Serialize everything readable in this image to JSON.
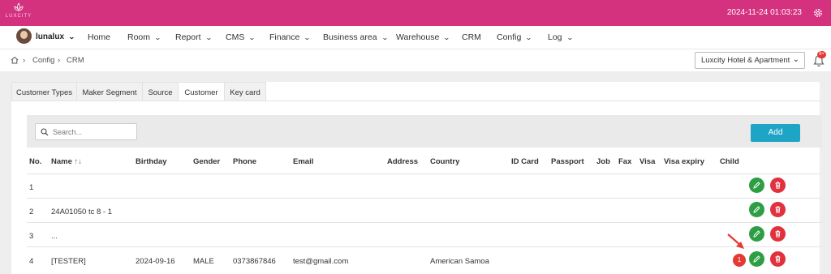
{
  "brand": {
    "logo_text": "LUXCITY",
    "color": "#d4317f"
  },
  "topbar": {
    "datetime": "2024-11-24 01:03:23"
  },
  "nav": {
    "username": "lunalux",
    "items": [
      "Home",
      "Room",
      "Report",
      "CMS",
      "Finance",
      "Business area",
      "Warehouse",
      "CRM",
      "Config",
      "Log"
    ]
  },
  "breadcrumb": {
    "items": [
      "Config",
      "CRM"
    ]
  },
  "hotel_select": {
    "value": "Luxcity Hotel & Apartment"
  },
  "notifications": {
    "count": "9+"
  },
  "tabs": [
    "Customer Types",
    "Maker Segment",
    "Source",
    "Customer",
    "Key card"
  ],
  "toolbar": {
    "search_placeholder": "Search...",
    "add_label": "Add"
  },
  "table": {
    "columns": [
      "No.",
      "Name",
      "Birthday",
      "Gender",
      "Phone",
      "Email",
      "Address",
      "Country",
      "ID Card",
      "Passport",
      "Job",
      "Fax",
      "Visa",
      "Visa expiry",
      "Child"
    ],
    "rows": [
      {
        "no": "1",
        "name": "",
        "birthday": "",
        "gender": "",
        "phone": "",
        "email": "",
        "country": ""
      },
      {
        "no": "2",
        "name": "24A01050 tc 8 - 1",
        "birthday": "",
        "gender": "",
        "phone": "",
        "email": "",
        "country": ""
      },
      {
        "no": "3",
        "name": "...",
        "birthday": "",
        "gender": "",
        "phone": "",
        "email": "",
        "country": ""
      },
      {
        "no": "4",
        "name": "[TESTER]",
        "birthday": "2024-09-16",
        "gender": "MALE",
        "phone": "0373867846",
        "email": "test@gmail.com",
        "country": "American Samoa"
      }
    ]
  },
  "annotation": {
    "step": "1"
  }
}
